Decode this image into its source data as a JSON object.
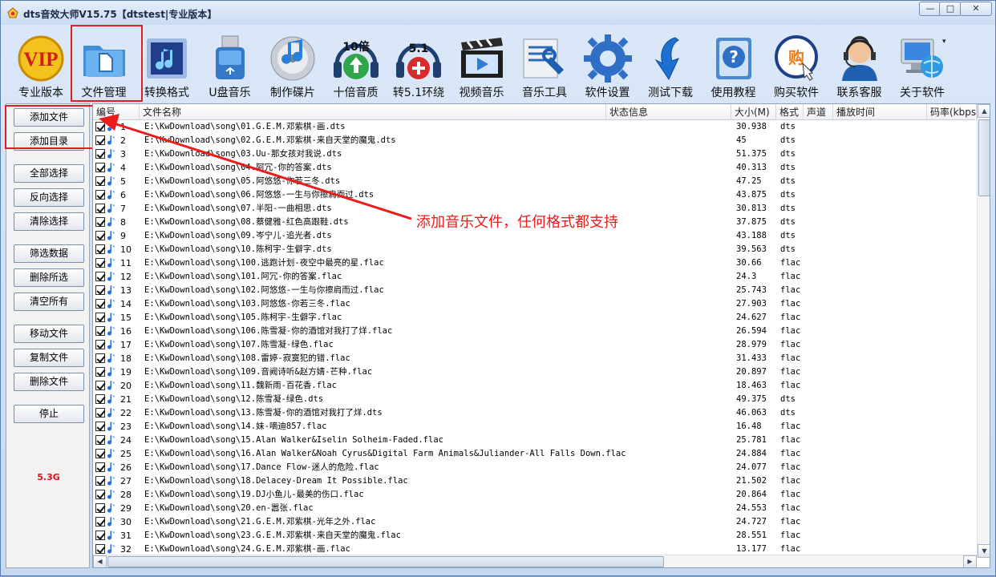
{
  "window": {
    "title": "dts音效大师V15.75【dtstest|专业版本】",
    "controls": {
      "minimize": "—",
      "maximize": "□",
      "close": "✕"
    }
  },
  "toolbar": {
    "items": [
      {
        "label": "专业版本",
        "icon": "vip-badge-icon"
      },
      {
        "label": "文件管理",
        "icon": "file-folder-icon"
      },
      {
        "label": "转换格式",
        "icon": "music-convert-icon"
      },
      {
        "label": "U盘音乐",
        "icon": "usb-drive-icon"
      },
      {
        "label": "制作碟片",
        "icon": "music-disc-icon"
      },
      {
        "label": "十倍音质",
        "icon": "headphones-10x-icon",
        "badge": "10倍"
      },
      {
        "label": "转5.1环绕",
        "icon": "headphones-51-icon",
        "badge": "5.1"
      },
      {
        "label": "视频音乐",
        "icon": "clapperboard-icon"
      },
      {
        "label": "音乐工具",
        "icon": "tools-icon"
      },
      {
        "label": "软件设置",
        "icon": "gear-icon"
      },
      {
        "label": "测试下载",
        "icon": "download-arrow-icon"
      },
      {
        "label": "使用教程",
        "icon": "help-book-icon"
      },
      {
        "label": "购买软件",
        "icon": "buy-cart-icon",
        "badge": "购"
      },
      {
        "label": "联系客服",
        "icon": "support-agent-icon"
      },
      {
        "label": "关于软件",
        "icon": "computer-globe-icon"
      }
    ],
    "more": "▾"
  },
  "sidebar": {
    "buttons": [
      "添加文件",
      "添加目录",
      "全部选择",
      "反向选择",
      "清除选择",
      "筛选数据",
      "删除所选",
      "清空所有",
      "移动文件",
      "复制文件",
      "删除文件",
      "停止"
    ],
    "size": "5.3G"
  },
  "table": {
    "columns": [
      "编号",
      "文件名称",
      "状态信息",
      "大小(M)",
      "格式",
      "声道",
      "播放时间",
      "码率(kbps"
    ],
    "rows": [
      {
        "no": "1",
        "name": "E:\\KwDownload\\song\\01.G.E.M.邓紫棋-画.dts",
        "size": "30.938",
        "ext": "dts"
      },
      {
        "no": "2",
        "name": "E:\\KwDownload\\song\\02.G.E.M.邓紫棋-来自天堂的魔鬼.dts",
        "size": "45",
        "ext": "dts"
      },
      {
        "no": "3",
        "name": "E:\\KwDownload\\song\\03.Uu-那女孩对我说.dts",
        "size": "51.375",
        "ext": "dts"
      },
      {
        "no": "4",
        "name": "E:\\KwDownload\\song\\04.阿冗-你的答案.dts",
        "size": "40.313",
        "ext": "dts"
      },
      {
        "no": "5",
        "name": "E:\\KwDownload\\song\\05.阿悠悠-你若三冬.dts",
        "size": "47.25",
        "ext": "dts"
      },
      {
        "no": "6",
        "name": "E:\\KwDownload\\song\\06.阿悠悠-一生与你擦肩而过.dts",
        "size": "43.875",
        "ext": "dts"
      },
      {
        "no": "7",
        "name": "E:\\KwDownload\\song\\07.半阳-一曲相思.dts",
        "size": "30.813",
        "ext": "dts"
      },
      {
        "no": "8",
        "name": "E:\\KwDownload\\song\\08.蔡健雅-红色高跟鞋.dts",
        "size": "37.875",
        "ext": "dts"
      },
      {
        "no": "9",
        "name": "E:\\KwDownload\\song\\09.岑宁儿-追光者.dts",
        "size": "43.188",
        "ext": "dts"
      },
      {
        "no": "10",
        "name": "E:\\KwDownload\\song\\10.陈柯宇-生僻字.dts",
        "size": "39.563",
        "ext": "dts"
      },
      {
        "no": "11",
        "name": "E:\\KwDownload\\song\\100.逃跑计划-夜空中最亮的星.flac",
        "size": "30.66",
        "ext": "flac"
      },
      {
        "no": "12",
        "name": "E:\\KwDownload\\song\\101.阿冗-你的答案.flac",
        "size": "24.3",
        "ext": "flac"
      },
      {
        "no": "13",
        "name": "E:\\KwDownload\\song\\102.阿悠悠-一生与你擦肩而过.flac",
        "size": "25.743",
        "ext": "flac"
      },
      {
        "no": "14",
        "name": "E:\\KwDownload\\song\\103.阿悠悠-你若三冬.flac",
        "size": "27.903",
        "ext": "flac"
      },
      {
        "no": "15",
        "name": "E:\\KwDownload\\song\\105.陈柯宇-生僻字.flac",
        "size": "24.627",
        "ext": "flac"
      },
      {
        "no": "16",
        "name": "E:\\KwDownload\\song\\106.陈雪凝-你的酒馆对我打了烊.flac",
        "size": "26.594",
        "ext": "flac"
      },
      {
        "no": "17",
        "name": "E:\\KwDownload\\song\\107.陈雪凝-绿色.flac",
        "size": "28.979",
        "ext": "flac"
      },
      {
        "no": "18",
        "name": "E:\\KwDownload\\song\\108.雷婷-寂寞犯的错.flac",
        "size": "31.433",
        "ext": "flac"
      },
      {
        "no": "19",
        "name": "E:\\KwDownload\\song\\109.音阙诗听&赵方婧-芒种.flac",
        "size": "20.897",
        "ext": "flac"
      },
      {
        "no": "20",
        "name": "E:\\KwDownload\\song\\11.魏新雨-百花香.flac",
        "size": "18.463",
        "ext": "flac"
      },
      {
        "no": "21",
        "name": "E:\\KwDownload\\song\\12.陈雪凝-绿色.dts",
        "size": "49.375",
        "ext": "dts"
      },
      {
        "no": "22",
        "name": "E:\\KwDownload\\song\\13.陈雪凝-你的酒馆对我打了烊.dts",
        "size": "46.063",
        "ext": "dts"
      },
      {
        "no": "23",
        "name": "E:\\KwDownload\\song\\14.妹-嘀迪857.flac",
        "size": "16.48",
        "ext": "flac"
      },
      {
        "no": "24",
        "name": "E:\\KwDownload\\song\\15.Alan Walker&Iselin Solheim-Faded.flac",
        "size": "25.781",
        "ext": "flac"
      },
      {
        "no": "25",
        "name": "E:\\KwDownload\\song\\16.Alan Walker&Noah Cyrus&Digital Farm Animals&Juliander-All Falls Down.flac",
        "size": "24.884",
        "ext": "flac"
      },
      {
        "no": "26",
        "name": "E:\\KwDownload\\song\\17.Dance Flow-迷人的危险.flac",
        "size": "24.077",
        "ext": "flac"
      },
      {
        "no": "27",
        "name": "E:\\KwDownload\\song\\18.Delacey-Dream It Possible.flac",
        "size": "21.502",
        "ext": "flac"
      },
      {
        "no": "28",
        "name": "E:\\KwDownload\\song\\19.DJ小鱼儿-最美的伤口.flac",
        "size": "20.864",
        "ext": "flac"
      },
      {
        "no": "29",
        "name": "E:\\KwDownload\\song\\20.en-嚣张.flac",
        "size": "24.553",
        "ext": "flac"
      },
      {
        "no": "30",
        "name": "E:\\KwDownload\\song\\21.G.E.M.邓紫棋-光年之外.flac",
        "size": "24.727",
        "ext": "flac"
      },
      {
        "no": "31",
        "name": "E:\\KwDownload\\song\\23.G.E.M.邓紫棋-来自天堂的魔鬼.flac",
        "size": "28.551",
        "ext": "flac"
      },
      {
        "no": "32",
        "name": "E:\\KwDownload\\song\\24.G.E.M.邓紫棋-画.flac",
        "size": "13.177",
        "ext": "flac"
      }
    ]
  },
  "annotation": {
    "text": "添加音乐文件，任何格式都支持",
    "color": "#ee1b1b"
  }
}
